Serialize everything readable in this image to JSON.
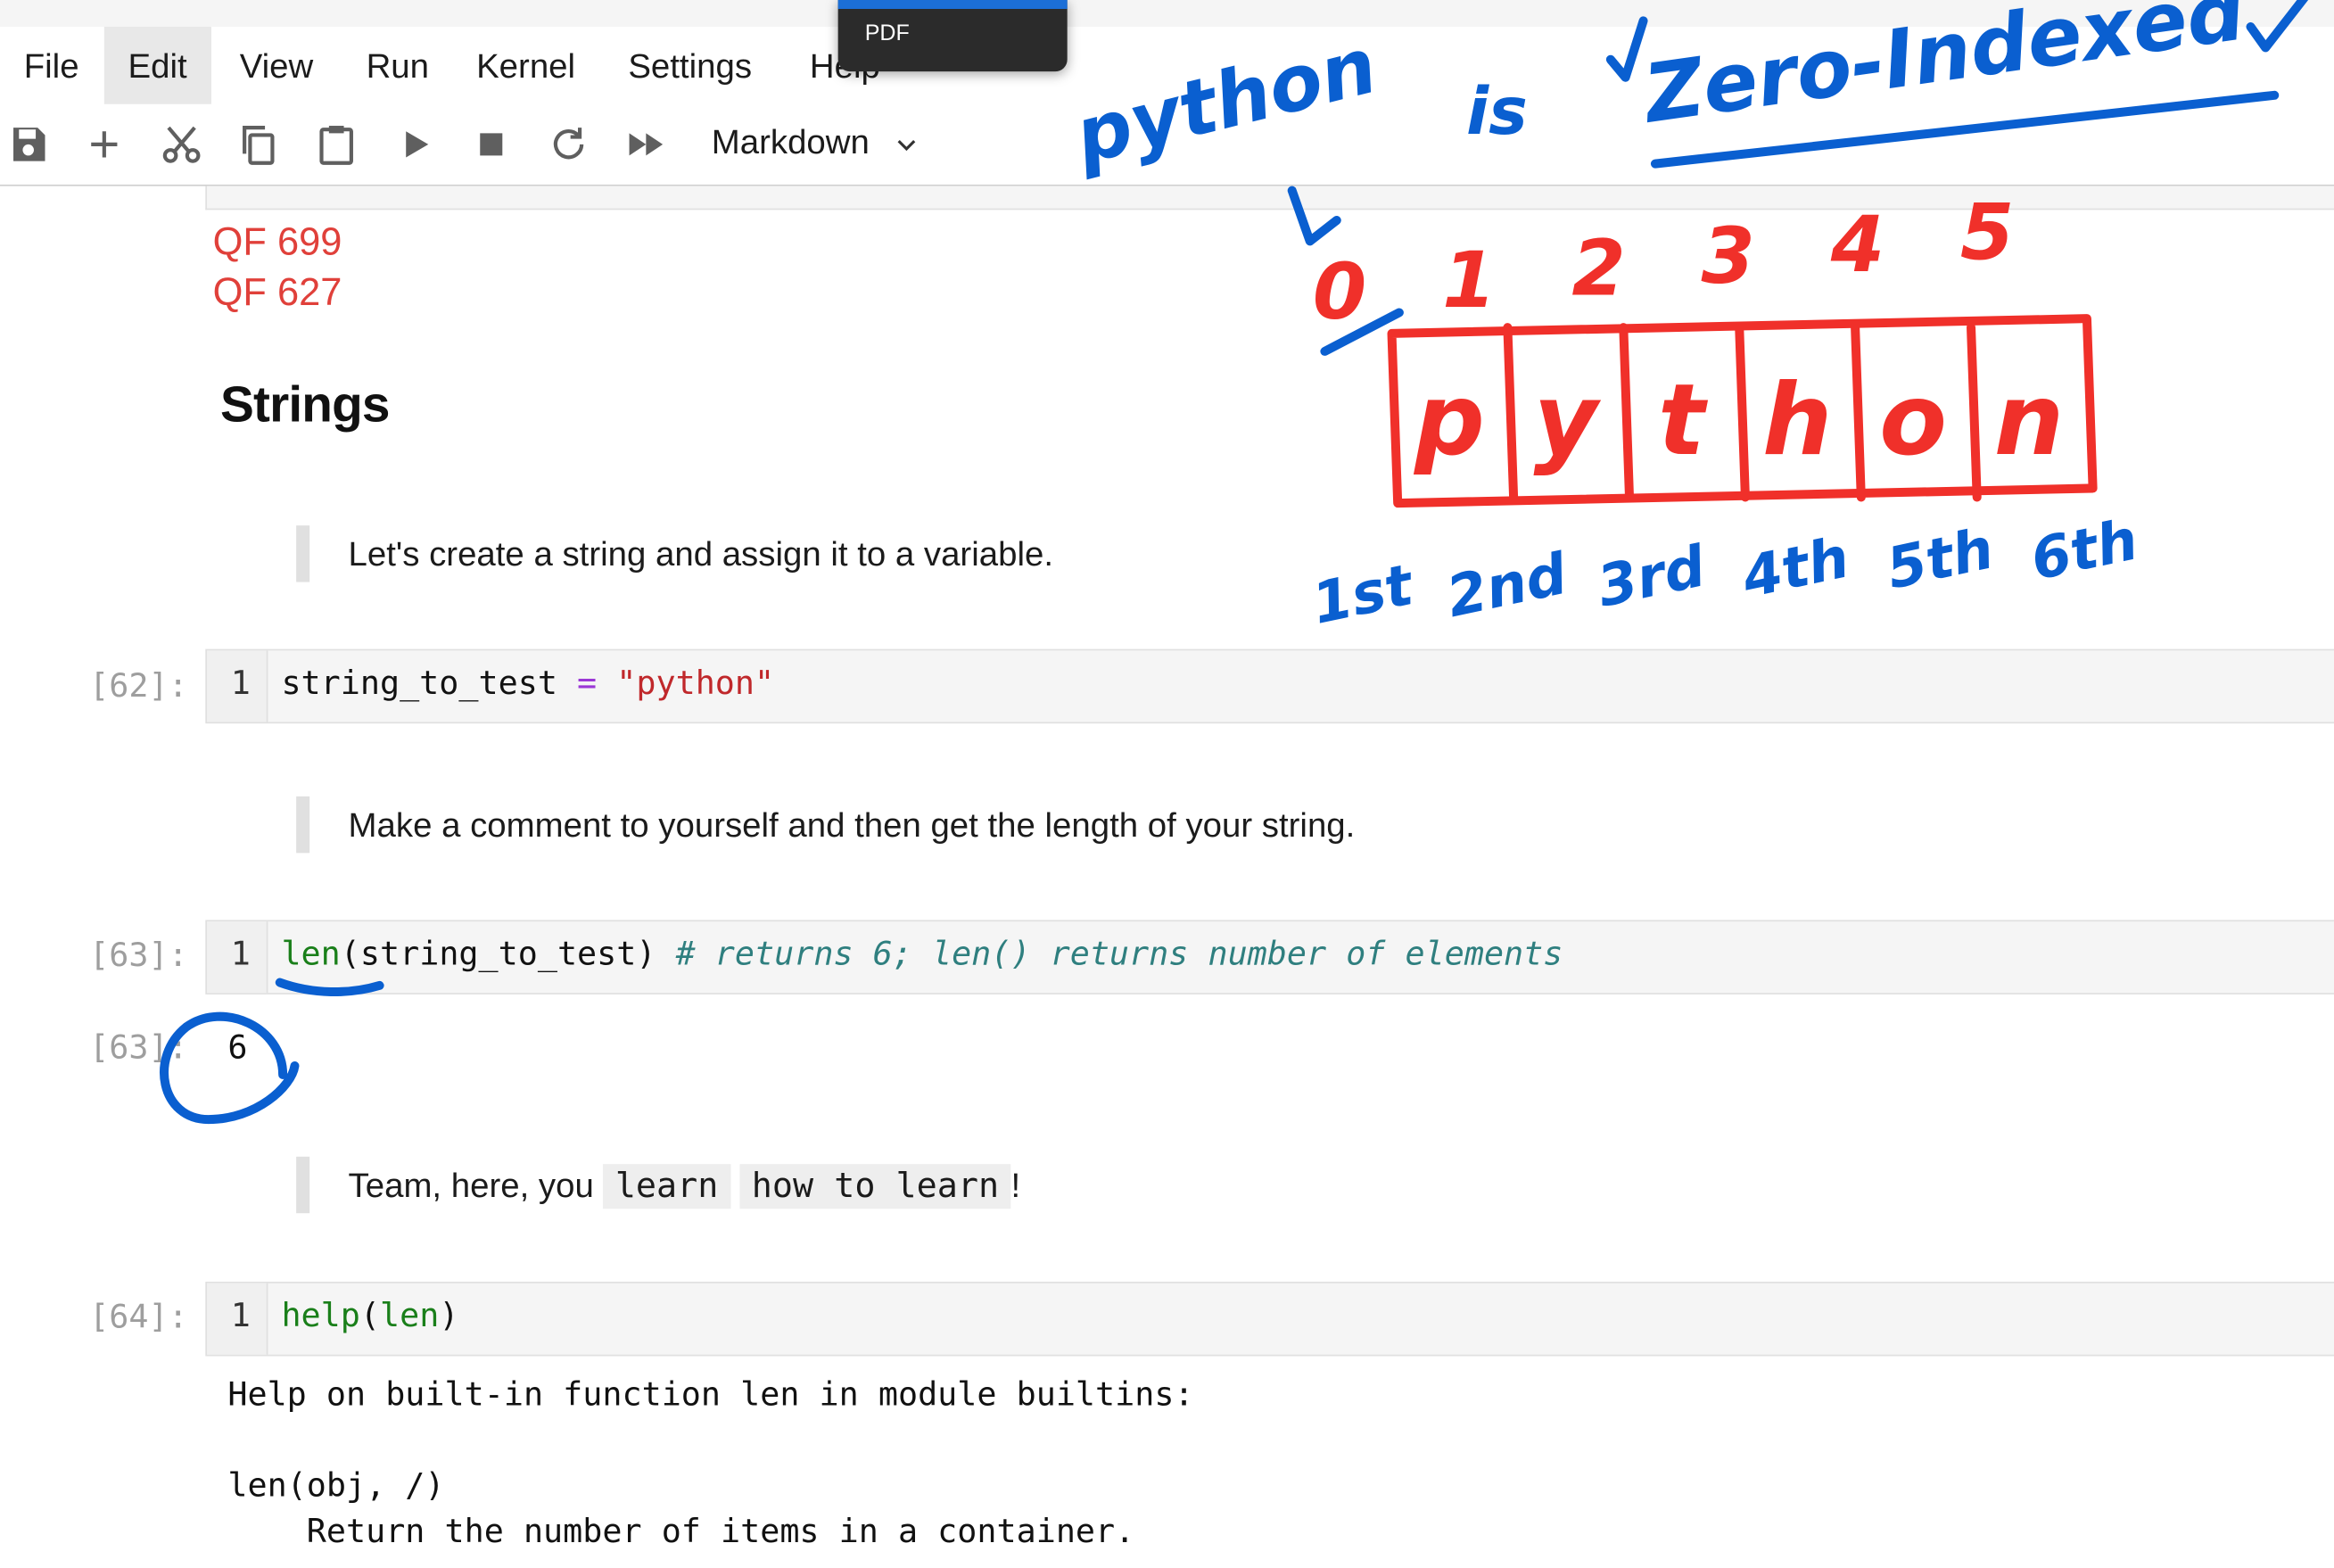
{
  "menubar": {
    "items": [
      "File",
      "Edit",
      "View",
      "Run",
      "Kernel",
      "Settings",
      "Help"
    ],
    "active": "Edit"
  },
  "popup": {
    "label": "PDF"
  },
  "toolbar": {
    "cell_type": "Markdown",
    "icons": [
      "save-icon",
      "add-icon",
      "cut-icon",
      "copy-icon",
      "paste-icon",
      "run-icon",
      "stop-icon",
      "restart-icon",
      "fast-forward-icon",
      "chevron-down-icon"
    ]
  },
  "notebook": {
    "prev_outputs": [
      "QF 699",
      "QF 627"
    ],
    "heading": "Strings",
    "note1": "Let's create a string and assign it to a variable.",
    "cell62": {
      "prompt": "[62]:",
      "line": "1",
      "var": "string_to_test",
      "op": "=",
      "str": "\"python\""
    },
    "note2": "Make a comment to yourself and then get the length of your string.",
    "cell63": {
      "prompt": "[63]:",
      "line": "1",
      "fn": "len",
      "args": "(string_to_test)",
      "comment": "# returns 6; len() returns number of elements",
      "out_prompt": "[63]:",
      "output": "6"
    },
    "note3": {
      "prefix": "Team, here, you",
      "code1": "learn",
      "code2": "how to learn",
      "suffix": "!"
    },
    "cell64": {
      "prompt": "[64]:",
      "line": "1",
      "fn": "help",
      "open": "(",
      "arg": "len",
      "close": ")",
      "output_lines": [
        "Help on built-in function len in module builtins:",
        "",
        "len(obj, /)",
        "    Return the number of items in a container."
      ]
    }
  },
  "annotations": {
    "blue_color": "#0a5fd0",
    "red_color": "#f0302a",
    "title_word": "python",
    "is_word": "is",
    "zero_indexed": "Zero-Indexed",
    "indices": [
      "0",
      "1",
      "2",
      "3",
      "4",
      "5"
    ],
    "letters": [
      "p",
      "y",
      "t",
      "h",
      "o",
      "n"
    ],
    "ordinals": [
      "1st",
      "2nd",
      "3rd",
      "4th",
      "5th",
      "6th"
    ]
  }
}
